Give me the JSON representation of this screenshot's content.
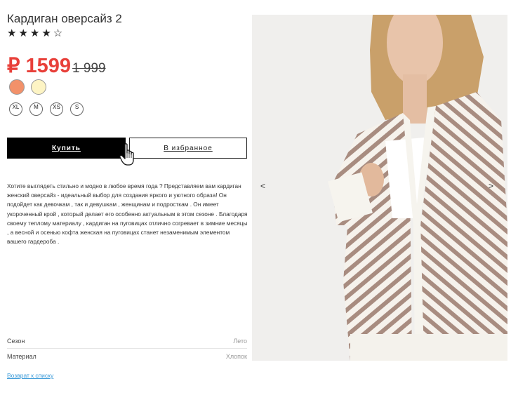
{
  "product": {
    "title": "Кардиган оверсайз 2",
    "stars": "★★★★☆",
    "rating": 4,
    "rating_max": 5,
    "price": "₽ 1599",
    "old_price": "1 999",
    "colors": [
      "#f2916a",
      "#fdf4c4"
    ],
    "sizes": [
      "XL",
      "M",
      "XS",
      "S"
    ],
    "buy_label": "Купить",
    "favorite_label": "В избранное",
    "description": "Хотите выглядеть стильно и модно в любое время года ? Представляем вам кардиган женский оверсайз - идеальный выбор для создания яркого и уютного образа! Он подойдет как девочкам , так и девушкам , женщинам и подросткам . Он имеет укороченный крой , который делает его особенно актуальным в этом сезоне . Благодаря своему теплому материалу , кардиган на пуговицах отлично согревает в зимние месяцы , а весной и осенью кофта женская на пуговицах станет незаменимым элементом вашего гардероба .",
    "specs": [
      {
        "key": "Сезон",
        "value": "Лето"
      },
      {
        "key": "Материал",
        "value": "Хлопок"
      }
    ],
    "back_link": "Возврат к списку"
  },
  "gallery": {
    "prev": "<",
    "next": ">"
  },
  "icons": {
    "cursor": "hand-pointer-cursor-icon",
    "photo": "product-photo"
  }
}
